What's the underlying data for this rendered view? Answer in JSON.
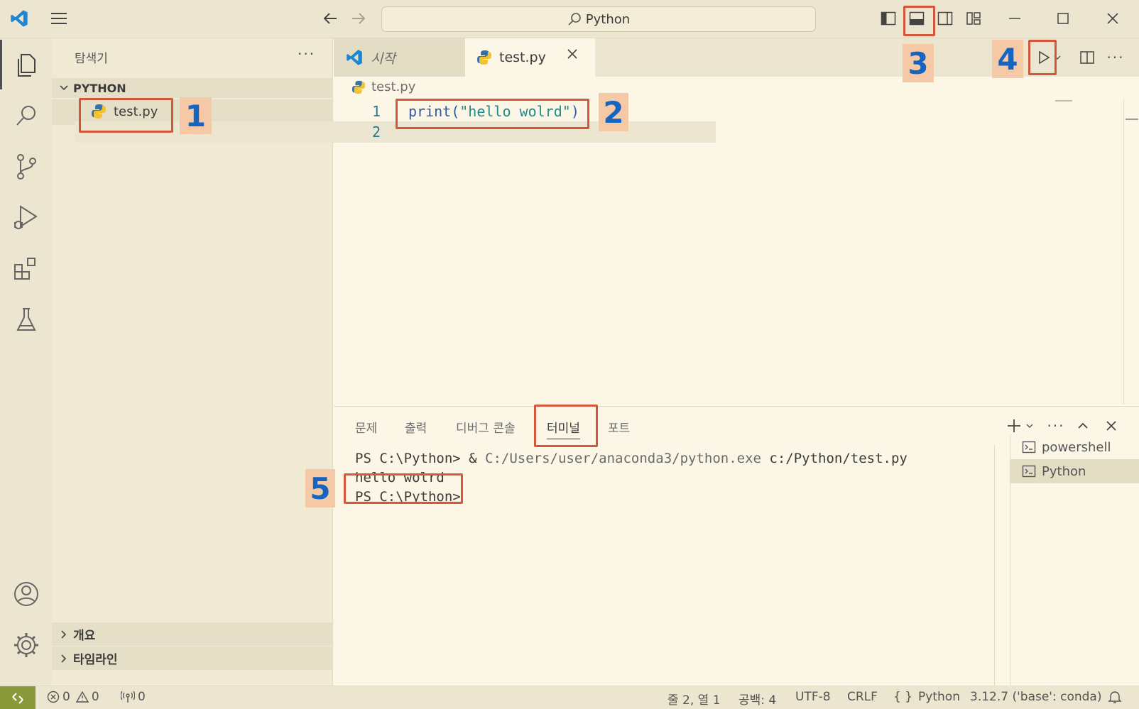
{
  "window": {
    "search_text": "Python"
  },
  "sidebar": {
    "title": "탐색기",
    "folder": "PYTHON",
    "file": "test.py",
    "outline": "개요",
    "timeline": "타임라인"
  },
  "tabs": [
    {
      "label": "시작"
    },
    {
      "label": "test.py"
    }
  ],
  "breadcrumb": "test.py",
  "editor": {
    "lines": [
      {
        "number": "1",
        "fn": "print",
        "open": "(",
        "str": "\"hello wolrd\"",
        "close": ")"
      },
      {
        "number": "2"
      }
    ]
  },
  "panel": {
    "tabs": [
      "문제",
      "출력",
      "디버그 콘솔",
      "터미널",
      "포트"
    ],
    "active_tab": "터미널",
    "terminal": {
      "line1_prompt": "PS C:\\Python> & ",
      "line1_exe": "C:/Users/user/anaconda3/python.exe",
      "line1_arg": " c:/Python/test.py",
      "line2": "hello wolrd",
      "line3": "PS C:\\Python>"
    },
    "terminals": [
      "powershell",
      "Python"
    ]
  },
  "statusbar": {
    "errors": "0",
    "warnings": "0",
    "ports": "0",
    "cursor": "줄 2, 열 1",
    "spaces": "공백: 4",
    "encoding": "UTF-8",
    "eol": "CRLF",
    "language": "Python",
    "interpreter": "3.12.7 ('base': conda)"
  },
  "annotations": [
    "1",
    "2",
    "3",
    "4",
    "5"
  ],
  "colors": {
    "annotation_border": "#d3573a",
    "annotation_bg": "#f6c9a6",
    "annotation_text": "#1565c0",
    "vscode_blue": "#007acc"
  }
}
